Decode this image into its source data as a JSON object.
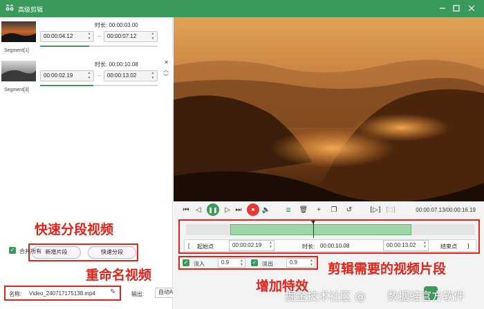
{
  "app": {
    "title": "高级剪辑"
  },
  "segments": [
    {
      "name": "Segment[1]",
      "duration_label": "时长:",
      "duration": "00:00:03.00",
      "start": "00:00:04.12",
      "end": "00:00:07.12",
      "progress": 0.42
    },
    {
      "name": "Segment[3]",
      "duration_label": "时长:",
      "duration": "00:00:10.08",
      "start": "00:00:02.19",
      "end": "00:00:13.02",
      "progress": 0.45
    }
  ],
  "left_controls": {
    "add_segment": "新增片段",
    "quick_split": "快速分段",
    "merge_all": "合并所有",
    "name_label": "名称:",
    "file_name": "Video_240717175138.mp4",
    "output_label": "输出:",
    "output_value": "自动Auto"
  },
  "annotations": {
    "quick_split": "快速分段视频",
    "rename": "重命名视频",
    "clip": "剪辑需要的视频片段",
    "effects": "增加特效"
  },
  "player": {
    "time": "00:00:07.13/00:00:16.19"
  },
  "clip_editor": {
    "bracket_left": "[",
    "start_label": "起始点",
    "start_value": "00:00:02.19",
    "duration_label": "时长:",
    "duration_value": "00:00:10.08",
    "end_value": "00:00:13.02",
    "end_label": "结束点",
    "bracket_right": "]",
    "fade_in_label": "淡入",
    "fade_in_value": "0.9",
    "fade_out_label": "淡出",
    "fade_out_value": "0.9",
    "selection": {
      "start_frac": 0.153,
      "end_frac": 0.78,
      "playhead_frac": 0.44
    }
  },
  "watermark": {
    "left": "掘金技术社区 @",
    "right": "数据蛙官方软件"
  },
  "colors": {
    "accent": "#3a9a5b",
    "annotation": "#e2231a",
    "record": "#e53935"
  }
}
